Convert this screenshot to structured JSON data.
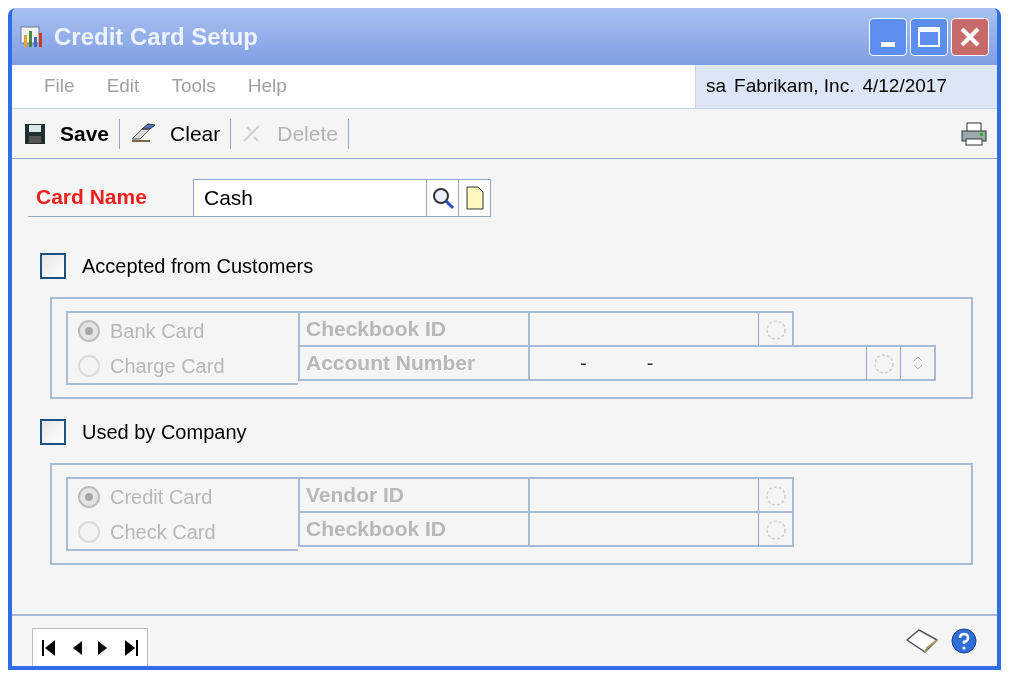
{
  "window": {
    "title": "Credit Card Setup"
  },
  "menu": [
    {
      "label": "File",
      "disabled": true
    },
    {
      "label": "Edit",
      "disabled": true
    },
    {
      "label": "Tools",
      "disabled": true
    },
    {
      "label": "Help",
      "disabled": true
    }
  ],
  "session": {
    "user": "sa",
    "company": "Fabrikam, Inc.",
    "date": "4/12/2017"
  },
  "toolbar": [
    {
      "kind": "save",
      "label": "Save",
      "disabled": false
    },
    {
      "kind": "clear",
      "label": "Clear",
      "disabled": false
    },
    {
      "kind": "delete",
      "label": "Delete",
      "disabled": true
    }
  ],
  "card_name": {
    "label": "Card Name",
    "value": "Cash"
  },
  "sections": [
    {
      "checkbox": {
        "label": "Accepted from Customers",
        "checked": false
      },
      "disabled": true,
      "options": [
        {
          "label": "Bank Card",
          "selected": true
        },
        {
          "label": "Charge Card",
          "selected": false
        }
      ],
      "fields": [
        {
          "label": "Checkbook ID",
          "kind": "id"
        },
        {
          "label": "Account Number",
          "kind": "account",
          "mask": [
            "-",
            "-"
          ]
        }
      ]
    },
    {
      "checkbox": {
        "label": "Used by Company",
        "checked": false
      },
      "disabled": true,
      "options": [
        {
          "label": "Credit Card",
          "selected": true
        },
        {
          "label": "Check Card",
          "selected": false
        }
      ],
      "fields": [
        {
          "label": "Vendor ID",
          "kind": "id"
        },
        {
          "label": "Checkbook ID",
          "kind": "id"
        }
      ]
    }
  ]
}
